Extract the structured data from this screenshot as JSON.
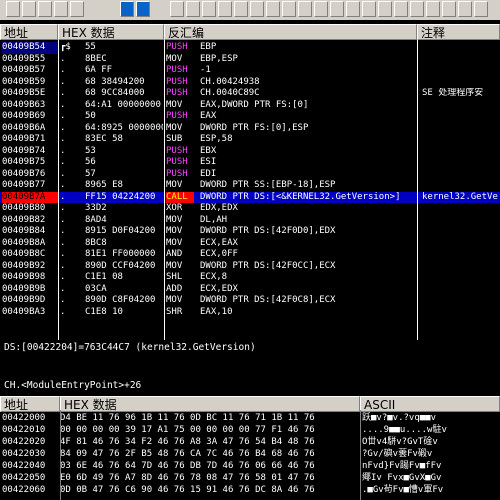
{
  "disasm_headers": {
    "addr": "地址",
    "hex": "HEX 数据",
    "disasm": "反汇编",
    "comment": "注释"
  },
  "colors": {
    "background": "#000000",
    "push": "#ff40ff",
    "mov": "#ffffff",
    "call_bg": "#ff0000",
    "call_text": "#ffff00",
    "selected_row": "#0000c0",
    "header": "#d4d0c8",
    "eip_bg": "#ff0000"
  },
  "disasm_rows": [
    {
      "addr": "00409B54",
      "mark": "┏$",
      "hex": "55",
      "mn": "PUSH",
      "ops": "EBP",
      "comment": "",
      "type": "push",
      "sel": "addr"
    },
    {
      "addr": "00409B55",
      "mark": ".",
      "hex": "8BEC",
      "mn": "MOV",
      "ops": "EBP,ESP",
      "comment": "",
      "type": "mov"
    },
    {
      "addr": "00409B57",
      "mark": ".",
      "hex": "6A FF",
      "mn": "PUSH",
      "ops": "-1",
      "comment": "",
      "type": "push"
    },
    {
      "addr": "00409B59",
      "mark": ".",
      "hex": "68 38494200",
      "mn": "PUSH",
      "ops": "CH.00424938",
      "comment": "",
      "type": "push"
    },
    {
      "addr": "00409B5E",
      "mark": ".",
      "hex": "68 9CC84000",
      "mn": "PUSH",
      "ops": "CH.0040C89C",
      "comment": "SE 处理程序安",
      "type": "push"
    },
    {
      "addr": "00409B63",
      "mark": ".",
      "hex": "64:A1 00000000",
      "mn": "MOV",
      "ops": "EAX,DWORD PTR FS:[0]",
      "comment": "",
      "type": "mov"
    },
    {
      "addr": "00409B69",
      "mark": ".",
      "hex": "50",
      "mn": "PUSH",
      "ops": "EAX",
      "comment": "",
      "type": "push"
    },
    {
      "addr": "00409B6A",
      "mark": ".",
      "hex": "64:8925 00000000",
      "mn": "MOV",
      "ops": "DWORD PTR FS:[0],ESP",
      "comment": "",
      "type": "mov"
    },
    {
      "addr": "00409B71",
      "mark": ".",
      "hex": "83EC 58",
      "mn": "SUB",
      "ops": "ESP,58",
      "comment": "",
      "type": "mov"
    },
    {
      "addr": "00409B74",
      "mark": ".",
      "hex": "53",
      "mn": "PUSH",
      "ops": "EBX",
      "comment": "",
      "type": "push"
    },
    {
      "addr": "00409B75",
      "mark": ".",
      "hex": "56",
      "mn": "PUSH",
      "ops": "ESI",
      "comment": "",
      "type": "push"
    },
    {
      "addr": "00409B76",
      "mark": ".",
      "hex": "57",
      "mn": "PUSH",
      "ops": "EDI",
      "comment": "",
      "type": "push"
    },
    {
      "addr": "00409B77",
      "mark": ".",
      "hex": "8965 E8",
      "mn": "MOV",
      "ops": "DWORD PTR SS:[EBP-18],ESP",
      "comment": "",
      "type": "mov"
    },
    {
      "addr": "00409B7A",
      "mark": ".",
      "hex": "FF15 04224200",
      "mn": "CALL",
      "ops": "DWORD PTR DS:[<&KERNEL32.GetVersion>]",
      "comment": "kernel32.GetVe",
      "type": "call",
      "sel": "row"
    },
    {
      "addr": "00409B80",
      "mark": ".",
      "hex": "33D2",
      "mn": "XOR",
      "ops": "EDX,EDX",
      "comment": "",
      "type": "mov"
    },
    {
      "addr": "00409B82",
      "mark": ".",
      "hex": "8AD4",
      "mn": "MOV",
      "ops": "DL,AH",
      "comment": "",
      "type": "mov"
    },
    {
      "addr": "00409B84",
      "mark": ".",
      "hex": "8915 D0F04200",
      "mn": "MOV",
      "ops": "DWORD PTR DS:[42F0D0],EDX",
      "comment": "",
      "type": "mov"
    },
    {
      "addr": "00409B8A",
      "mark": ".",
      "hex": "8BC8",
      "mn": "MOV",
      "ops": "ECX,EAX",
      "comment": "",
      "type": "mov"
    },
    {
      "addr": "00409B8C",
      "mark": ".",
      "hex": "81E1 FF000000",
      "mn": "AND",
      "ops": "ECX,0FF",
      "comment": "",
      "type": "mov"
    },
    {
      "addr": "00409B92",
      "mark": ".",
      "hex": "890D CCF04200",
      "mn": "MOV",
      "ops": "DWORD PTR DS:[42F0CC],ECX",
      "comment": "",
      "type": "mov"
    },
    {
      "addr": "00409B98",
      "mark": ".",
      "hex": "C1E1 08",
      "mn": "SHL",
      "ops": "ECX,8",
      "comment": "",
      "type": "mov"
    },
    {
      "addr": "00409B9B",
      "mark": ".",
      "hex": "03CA",
      "mn": "ADD",
      "ops": "ECX,EDX",
      "comment": "",
      "type": "mov"
    },
    {
      "addr": "00409B9D",
      "mark": ".",
      "hex": "890D C8F04200",
      "mn": "MOV",
      "ops": "DWORD PTR DS:[42F0C8],ECX",
      "comment": "",
      "type": "mov"
    },
    {
      "addr": "00409BA3",
      "mark": ".",
      "hex": "C1E8 10",
      "mn": "SHR",
      "ops": "EAX,10",
      "comment": "",
      "type": "mov"
    }
  ],
  "info_line1": "DS:[00422204]=763C44C7 (kernel32.GetVersion)",
  "info_line2": "CH.<ModuleEntryPoint>+26",
  "dump_headers": {
    "addr": "地址",
    "hex": "HEX 数据",
    "ascii": "ASCII"
  },
  "dump_rows": [
    {
      "addr": "00422000",
      "hex": "D4 BE 11 76 96 1B 11 76 0D BC 11 76 71 1B 11 76",
      "ascii": "跃■v?■v.?vq■■v"
    },
    {
      "addr": "00422010",
      "hex": "00 00 00 00 39 17 A1 75 00 00 00 00 77 F1 46 76",
      "ascii": "....9■■u....w駐v"
    },
    {
      "addr": "00422020",
      "hex": "4F 81 46 76 34 F2 46 76 A8 3A 47 76 54 B4 48 76",
      "ascii": "O丗v4駢v?GvT碒v"
    },
    {
      "addr": "00422030",
      "hex": "84 09 47 76 2F B5 48 76 CA 7C 46 76 B4 68 46 76",
      "ascii": "?Gv/礖v蕓Fv碫v"
    },
    {
      "addr": "00422040",
      "hex": "03 6E 46 76 64 7D 46 76 DB 7D 46 76 06 66 46 76",
      "ascii": "nFvd}Fv踼Fv■fFv"
    },
    {
      "addr": "00422050",
      "hex": "E0 6D 49 76 A7 8D 46 76 78 08 47 76 58 01 47 76",
      "ascii": "鄊Iv  Fvx■GvX■Gv"
    },
    {
      "addr": "00422060",
      "hex": "0D 0B 47 76 C6 90 46 76 15 91 46 76 DC 8A 46 76",
      "ascii": ".■Gv茍Fv■慒v軍Fv"
    }
  ]
}
